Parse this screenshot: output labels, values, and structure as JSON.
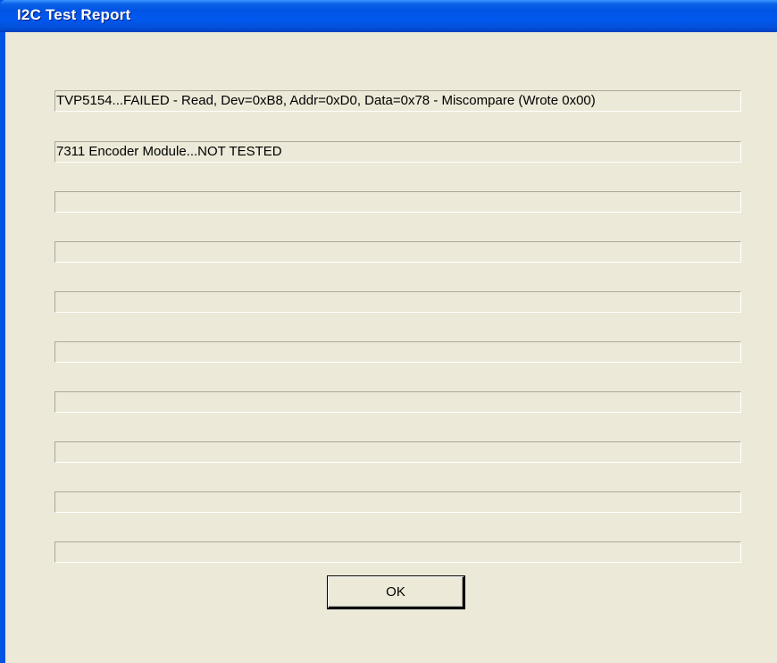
{
  "window": {
    "title": "I2C Test Report"
  },
  "results": [
    "TVP5154...FAILED - Read,  Dev=0xB8, Addr=0xD0, Data=0x78 - Miscompare (Wrote 0x00)",
    "7311 Encoder Module...NOT TESTED",
    "",
    "",
    "",
    "",
    "",
    "",
    "",
    ""
  ],
  "buttons": {
    "ok_label": "OK"
  },
  "colors": {
    "titlebar": "#0054e3",
    "dialog_background": "#ece9d8"
  }
}
